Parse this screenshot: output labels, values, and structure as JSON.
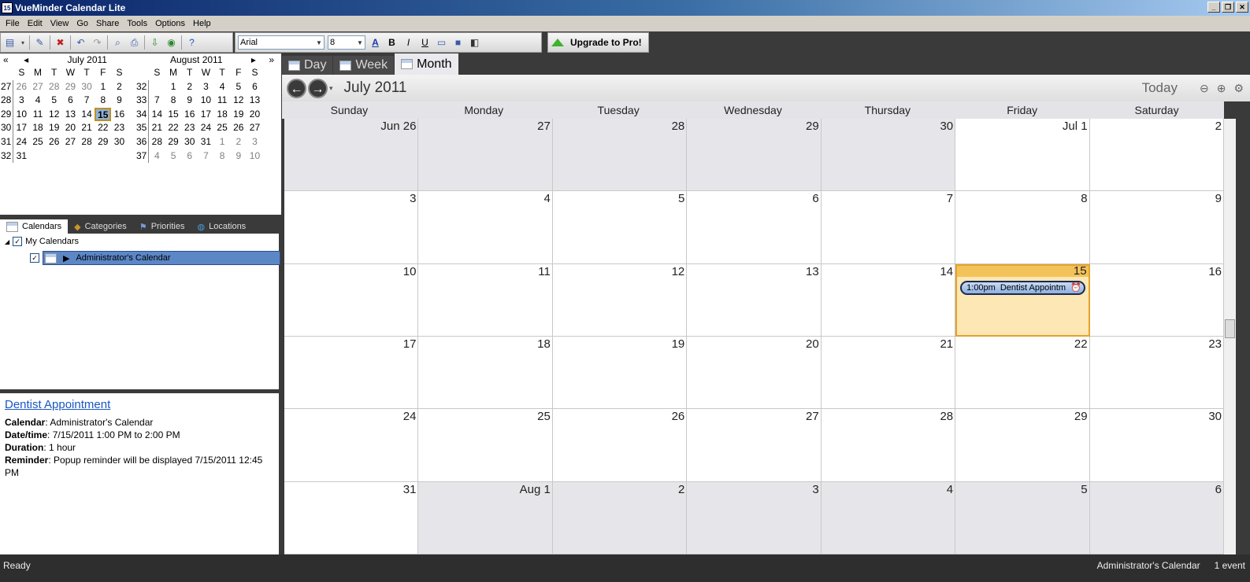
{
  "window": {
    "title": "VueMinder Calendar Lite",
    "icon_text": "15"
  },
  "menu": [
    "File",
    "Edit",
    "View",
    "Go",
    "Share",
    "Tools",
    "Options",
    "Help"
  ],
  "toolbar": {
    "font": "Arial",
    "size": "8",
    "upgrade_label": "Upgrade to Pro!"
  },
  "mini_calendars": [
    {
      "title": "July 2011",
      "days_header": [
        "S",
        "M",
        "T",
        "W",
        "T",
        "F",
        "S"
      ],
      "weeks": [
        {
          "wk": "27",
          "days": [
            "26",
            "27",
            "28",
            "29",
            "30",
            "1",
            "2"
          ]
        },
        {
          "wk": "28",
          "days": [
            "3",
            "4",
            "5",
            "6",
            "7",
            "8",
            "9"
          ]
        },
        {
          "wk": "29",
          "days": [
            "10",
            "11",
            "12",
            "13",
            "14",
            "15",
            "16"
          ]
        },
        {
          "wk": "30",
          "days": [
            "17",
            "18",
            "19",
            "20",
            "21",
            "22",
            "23"
          ]
        },
        {
          "wk": "31",
          "days": [
            "24",
            "25",
            "26",
            "27",
            "28",
            "29",
            "30"
          ]
        },
        {
          "wk": "32",
          "days": [
            "31",
            "",
            "",
            "",
            "",
            "",
            ""
          ]
        }
      ]
    },
    {
      "title": "August 2011",
      "days_header": [
        "S",
        "M",
        "T",
        "W",
        "T",
        "F",
        "S"
      ],
      "weeks": [
        {
          "wk": "32",
          "days": [
            "",
            "1",
            "2",
            "3",
            "4",
            "5",
            "6"
          ]
        },
        {
          "wk": "33",
          "days": [
            "7",
            "8",
            "9",
            "10",
            "11",
            "12",
            "13"
          ]
        },
        {
          "wk": "34",
          "days": [
            "14",
            "15",
            "16",
            "17",
            "18",
            "19",
            "20"
          ]
        },
        {
          "wk": "35",
          "days": [
            "21",
            "22",
            "23",
            "24",
            "25",
            "26",
            "27"
          ]
        },
        {
          "wk": "36",
          "days": [
            "28",
            "29",
            "30",
            "31",
            "1",
            "2",
            "3"
          ]
        },
        {
          "wk": "37",
          "days": [
            "4",
            "5",
            "6",
            "7",
            "8",
            "9",
            "10"
          ]
        }
      ]
    }
  ],
  "side_tabs": [
    "Calendars",
    "Categories",
    "Priorities",
    "Locations"
  ],
  "tree": {
    "group": "My Calendars",
    "calendar": "Administrator's Calendar"
  },
  "details": {
    "title": "Dentist Appointment",
    "calendar_label": "Calendar",
    "calendar_value": "Administrator's Calendar",
    "datetime_label": "Date/time",
    "datetime_value": "7/15/2011 1:00 PM to 2:00 PM",
    "duration_label": "Duration",
    "duration_value": "1 hour",
    "reminder_label": "Reminder",
    "reminder_value": "Popup reminder will be displayed 7/15/2011 12:45 PM"
  },
  "views": [
    "Day",
    "Week",
    "Month"
  ],
  "nav": {
    "month_title": "July 2011",
    "today_label": "Today"
  },
  "weekdays": [
    "Sunday",
    "Monday",
    "Tuesday",
    "Wednesday",
    "Thursday",
    "Friday",
    "Saturday"
  ],
  "month_cells": [
    [
      "Jun 26",
      "27",
      "28",
      "29",
      "30",
      "Jul 1",
      "2"
    ],
    [
      "3",
      "4",
      "5",
      "6",
      "7",
      "8",
      "9"
    ],
    [
      "10",
      "11",
      "12",
      "13",
      "14",
      "15",
      "16"
    ],
    [
      "17",
      "18",
      "19",
      "20",
      "21",
      "22",
      "23"
    ],
    [
      "24",
      "25",
      "26",
      "27",
      "28",
      "29",
      "30"
    ],
    [
      "31",
      "Aug 1",
      "2",
      "3",
      "4",
      "5",
      "6"
    ]
  ],
  "event": {
    "time": "1:00pm",
    "title": "Dentist Appointm"
  },
  "status": {
    "left": "Ready",
    "calendar": "Administrator's Calendar",
    "count": "1 event"
  }
}
